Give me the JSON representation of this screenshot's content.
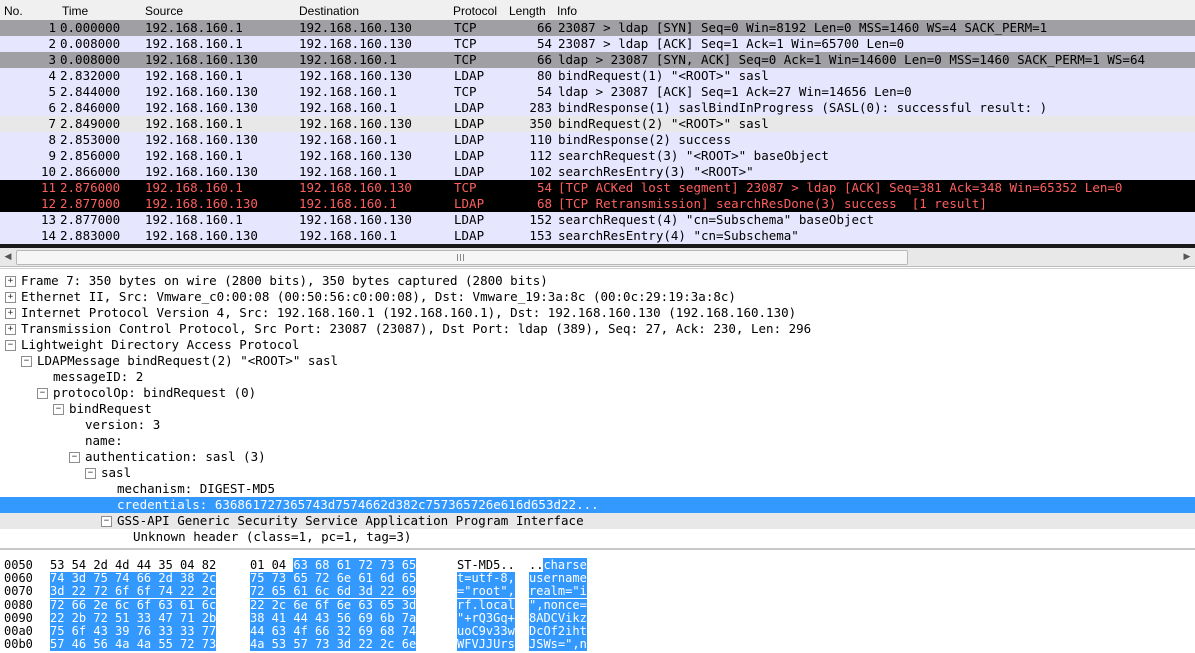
{
  "packet_list": {
    "columns": [
      "No.",
      "Time",
      "Source",
      "Destination",
      "Protocol",
      "Length",
      "Info"
    ],
    "rows": [
      {
        "no": "1",
        "time": "0.000000",
        "src": "192.168.160.1",
        "dst": "192.168.160.130",
        "proto": "TCP",
        "len": "66",
        "info": "23087 > ldap [SYN] Seq=0 Win=8192 Len=0 MSS=1460 WS=4 SACK_PERM=1",
        "bg": "#a0a0a4",
        "fg": "#000000"
      },
      {
        "no": "2",
        "time": "0.008000",
        "src": "192.168.160.1",
        "dst": "192.168.160.130",
        "proto": "TCP",
        "len": "54",
        "info": "23087 > ldap [ACK] Seq=1 Ack=1 Win=65700 Len=0",
        "bg": "#e7e6ff",
        "fg": "#000000"
      },
      {
        "no": "3",
        "time": "0.008000",
        "src": "192.168.160.130",
        "dst": "192.168.160.1",
        "proto": "TCP",
        "len": "66",
        "info": "ldap > 23087 [SYN, ACK] Seq=0 Ack=1 Win=14600 Len=0 MSS=1460 SACK_PERM=1 WS=64",
        "bg": "#a0a0a4",
        "fg": "#000000"
      },
      {
        "no": "4",
        "time": "2.832000",
        "src": "192.168.160.1",
        "dst": "192.168.160.130",
        "proto": "LDAP",
        "len": "80",
        "info": "bindRequest(1) \"<ROOT>\" sasl",
        "bg": "#e7e6ff",
        "fg": "#000000"
      },
      {
        "no": "5",
        "time": "2.844000",
        "src": "192.168.160.130",
        "dst": "192.168.160.1",
        "proto": "TCP",
        "len": "54",
        "info": "ldap > 23087 [ACK] Seq=1 Ack=27 Win=14656 Len=0",
        "bg": "#e7e6ff",
        "fg": "#000000"
      },
      {
        "no": "6",
        "time": "2.846000",
        "src": "192.168.160.130",
        "dst": "192.168.160.1",
        "proto": "LDAP",
        "len": "283",
        "info": "bindResponse(1) saslBindInProgress (SASL(0): successful result: )",
        "bg": "#e7e6ff",
        "fg": "#000000"
      },
      {
        "no": "7",
        "time": "2.849000",
        "src": "192.168.160.1",
        "dst": "192.168.160.130",
        "proto": "LDAP",
        "len": "350",
        "info": "bindRequest(2) \"<ROOT>\" sasl",
        "bg": "#e8e8e8",
        "fg": "#000000"
      },
      {
        "no": "8",
        "time": "2.853000",
        "src": "192.168.160.130",
        "dst": "192.168.160.1",
        "proto": "LDAP",
        "len": "110",
        "info": "bindResponse(2) success",
        "bg": "#e7e6ff",
        "fg": "#000000"
      },
      {
        "no": "9",
        "time": "2.856000",
        "src": "192.168.160.1",
        "dst": "192.168.160.130",
        "proto": "LDAP",
        "len": "112",
        "info": "searchRequest(3) \"<ROOT>\" baseObject",
        "bg": "#e7e6ff",
        "fg": "#000000"
      },
      {
        "no": "10",
        "time": "2.866000",
        "src": "192.168.160.130",
        "dst": "192.168.160.1",
        "proto": "LDAP",
        "len": "102",
        "info": "searchResEntry(3) \"<ROOT>\"",
        "bg": "#e7e6ff",
        "fg": "#000000"
      },
      {
        "no": "11",
        "time": "2.876000",
        "src": "192.168.160.1",
        "dst": "192.168.160.130",
        "proto": "TCP",
        "len": "54",
        "info": "[TCP ACKed lost segment] 23087 > ldap [ACK] Seq=381 Ack=348 Win=65352 Len=0",
        "bg": "#000000",
        "fg": "#ff5f5f"
      },
      {
        "no": "12",
        "time": "2.877000",
        "src": "192.168.160.130",
        "dst": "192.168.160.1",
        "proto": "LDAP",
        "len": "68",
        "info": "[TCP Retransmission] searchResDone(3) success  [1 result]",
        "bg": "#000000",
        "fg": "#ff5f5f"
      },
      {
        "no": "13",
        "time": "2.877000",
        "src": "192.168.160.1",
        "dst": "192.168.160.130",
        "proto": "LDAP",
        "len": "152",
        "info": "searchRequest(4) \"cn=Subschema\" baseObject",
        "bg": "#e7e6ff",
        "fg": "#000000"
      },
      {
        "no": "14",
        "time": "2.883000",
        "src": "192.168.160.130",
        "dst": "192.168.160.1",
        "proto": "LDAP",
        "len": "153",
        "info": "searchResEntry(4) \"cn=Subschema\"",
        "bg": "#e7e6ff",
        "fg": "#000000"
      }
    ]
  },
  "details": [
    {
      "text": "Frame 7: 350 bytes on wire (2800 bits), 350 bytes captured (2800 bits)",
      "level": 0,
      "expander": "+",
      "name": "tree-frame",
      "state": ""
    },
    {
      "text": "Ethernet II, Src: Vmware_c0:00:08 (00:50:56:c0:00:08), Dst: Vmware_19:3a:8c (00:0c:29:19:3a:8c)",
      "level": 0,
      "expander": "+",
      "name": "tree-ethernet",
      "state": ""
    },
    {
      "text": "Internet Protocol Version 4, Src: 192.168.160.1 (192.168.160.1), Dst: 192.168.160.130 (192.168.160.130)",
      "level": 0,
      "expander": "+",
      "name": "tree-ipv4",
      "state": ""
    },
    {
      "text": "Transmission Control Protocol, Src Port: 23087 (23087), Dst Port: ldap (389), Seq: 27, Ack: 230, Len: 296",
      "level": 0,
      "expander": "+",
      "name": "tree-tcp",
      "state": ""
    },
    {
      "text": "Lightweight Directory Access Protocol",
      "level": 0,
      "expander": "-",
      "name": "tree-ldap",
      "state": ""
    },
    {
      "text": "LDAPMessage bindRequest(2) \"<ROOT>\" sasl",
      "level": 1,
      "expander": "-",
      "name": "tree-ldap-message",
      "state": ""
    },
    {
      "text": "messageID: 2",
      "level": 2,
      "expander": "",
      "name": "tree-message-id",
      "state": ""
    },
    {
      "text": "protocolOp: bindRequest (0)",
      "level": 2,
      "expander": "-",
      "name": "tree-protocol-op",
      "state": ""
    },
    {
      "text": "bindRequest",
      "level": 3,
      "expander": "-",
      "name": "tree-bind-request",
      "state": ""
    },
    {
      "text": "version: 3",
      "level": 4,
      "expander": "",
      "name": "tree-version",
      "state": ""
    },
    {
      "text": "name:",
      "level": 4,
      "expander": "",
      "name": "tree-name",
      "state": ""
    },
    {
      "text": "authentication: sasl (3)",
      "level": 4,
      "expander": "-",
      "name": "tree-authentication",
      "state": ""
    },
    {
      "text": "sasl",
      "level": 5,
      "expander": "-",
      "name": "tree-sasl",
      "state": ""
    },
    {
      "text": "mechanism: DIGEST-MD5",
      "level": 6,
      "expander": "",
      "name": "tree-mechanism",
      "state": ""
    },
    {
      "text": "credentials: 636861727365743d7574662d382c757365726e616d653d22...",
      "level": 6,
      "expander": "",
      "name": "tree-credentials",
      "state": "sel"
    },
    {
      "text": "GSS-API Generic Security Service Application Program Interface",
      "level": 6,
      "expander": "-",
      "name": "tree-gss-api",
      "state": "hl"
    },
    {
      "text": "Unknown header (class=1, pc=1, tag=3)",
      "level": 7,
      "expander": "",
      "name": "tree-unknown-header",
      "state": ""
    }
  ],
  "bytes": [
    {
      "off": "0050",
      "hex1": "53 54 2d 4d 44 35 04 82",
      "hex2": "01 04 63 68 61 72 73 65",
      "asc1": "ST-MD5..",
      "asc2": "..charse",
      "sel_hex1": false,
      "sel_hex2_from": 6,
      "sel_asc2_from": 2,
      "sel_asc1": false
    },
    {
      "off": "0060",
      "hex1": "74 3d 75 74 66 2d 38 2c",
      "hex2": "75 73 65 72 6e 61 6d 65",
      "asc1": "t=utf-8,",
      "asc2": "username",
      "sel_hex1": true,
      "sel_hex2_from": 0,
      "sel_asc2_from": 0,
      "sel_asc1": true
    },
    {
      "off": "0070",
      "hex1": "3d 22 72 6f 6f 74 22 2c",
      "hex2": "72 65 61 6c 6d 3d 22 69",
      "asc1": "=\"root\",",
      "asc2": "realm=\"i",
      "sel_hex1": true,
      "sel_hex2_from": 0,
      "sel_asc2_from": 0,
      "sel_asc1": true
    },
    {
      "off": "0080",
      "hex1": "72 66 2e 6c 6f 63 61 6c",
      "hex2": "22 2c 6e 6f 6e 63 65 3d",
      "asc1": "rf.local",
      "asc2": "\",nonce=",
      "sel_hex1": true,
      "sel_hex2_from": 0,
      "sel_asc2_from": 0,
      "sel_asc1": true
    },
    {
      "off": "0090",
      "hex1": "22 2b 72 51 33 47 71 2b",
      "hex2": "38 41 44 43 56 69 6b 7a",
      "asc1": "\"+rQ3Gq+",
      "asc2": "8ADCVikz",
      "sel_hex1": true,
      "sel_hex2_from": 0,
      "sel_asc2_from": 0,
      "sel_asc1": true
    },
    {
      "off": "00a0",
      "hex1": "75 6f 43 39 76 33 33 77",
      "hex2": "44 63 4f 66 32 69 68 74",
      "asc1": "uoC9v33w",
      "asc2": "DcOf2iht",
      "sel_hex1": true,
      "sel_hex2_from": 0,
      "sel_asc2_from": 0,
      "sel_asc1": true
    },
    {
      "off": "00b0",
      "hex1": "57 46 56 4a 4a 55 72 73",
      "hex2": "4a 53 57 73 3d 22 2c 6e",
      "asc1": "WFVJJUrs",
      "asc2": "JSWs=\",n",
      "sel_hex1": true,
      "sel_hex2_from": 0,
      "sel_asc2_from": 0,
      "sel_asc1": true
    }
  ],
  "scrollbar": {
    "left_arrow": "◀",
    "right_arrow": "▶"
  }
}
